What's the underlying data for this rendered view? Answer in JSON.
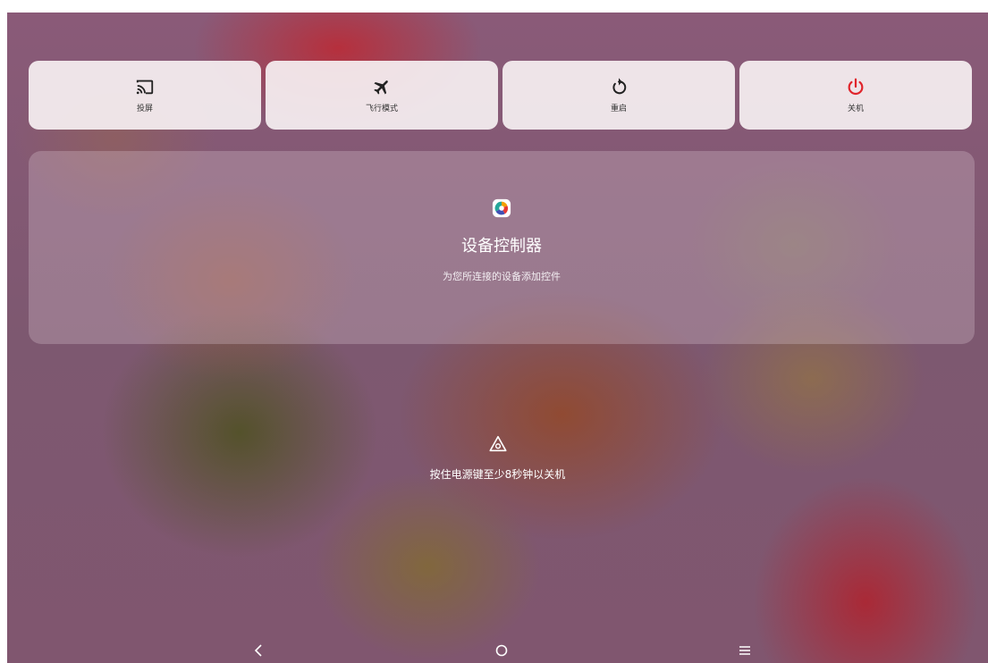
{
  "quick_tiles": [
    {
      "id": "cast",
      "label": "投屏",
      "icon": "cast-icon"
    },
    {
      "id": "airplane",
      "label": "飞行模式",
      "icon": "airplane-icon"
    },
    {
      "id": "restart",
      "label": "重启",
      "icon": "restart-icon"
    },
    {
      "id": "power_off",
      "label": "关机",
      "icon": "power-icon",
      "color": "#e0252c"
    }
  ],
  "device_controls": {
    "title": "设备控制器",
    "subtitle": "为您所连接的设备添加控件",
    "icon": "device-controls-app-icon"
  },
  "power_hint": {
    "text": "按住电源键至少8秒钟以关机",
    "icon": "power-key-hint-icon"
  },
  "nav_bar": [
    {
      "id": "back",
      "icon": "back-icon"
    },
    {
      "id": "home",
      "icon": "home-icon"
    },
    {
      "id": "menu",
      "icon": "menu-icon"
    }
  ],
  "colors": {
    "power_accent": "#e0252c",
    "tile_bg": "#f6f0f2"
  }
}
